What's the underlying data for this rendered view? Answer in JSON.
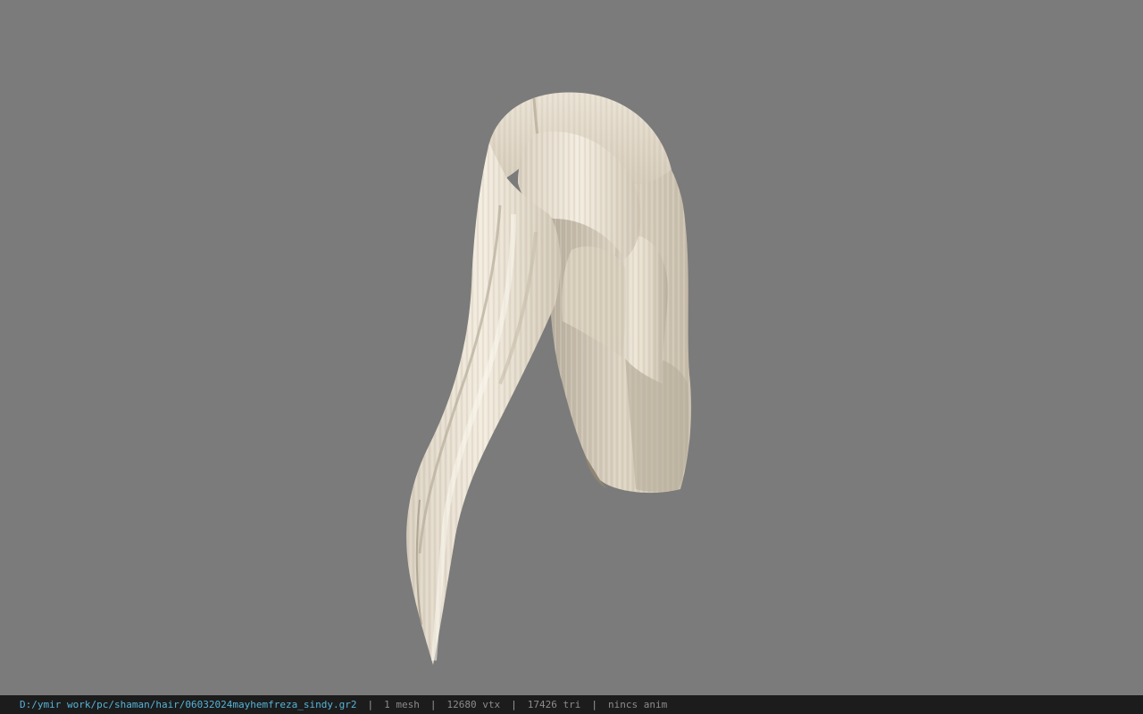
{
  "viewport": {
    "background_color": "#7b7b7b",
    "model": {
      "icon": "hair-mesh",
      "hair_color": "#e6dccb",
      "shadow_color": "#a89c88"
    }
  },
  "status_bar": {
    "file_path": "D:/ymir work/pc/shaman/hair/06032024mayhemfreza_sindy.gr2",
    "separator": "|",
    "mesh_count": "1 mesh",
    "vertex_count": "12680 vtx",
    "triangle_count": "17426 tri",
    "anim_status": "nincs anim",
    "path_color": "#56b4d8"
  }
}
